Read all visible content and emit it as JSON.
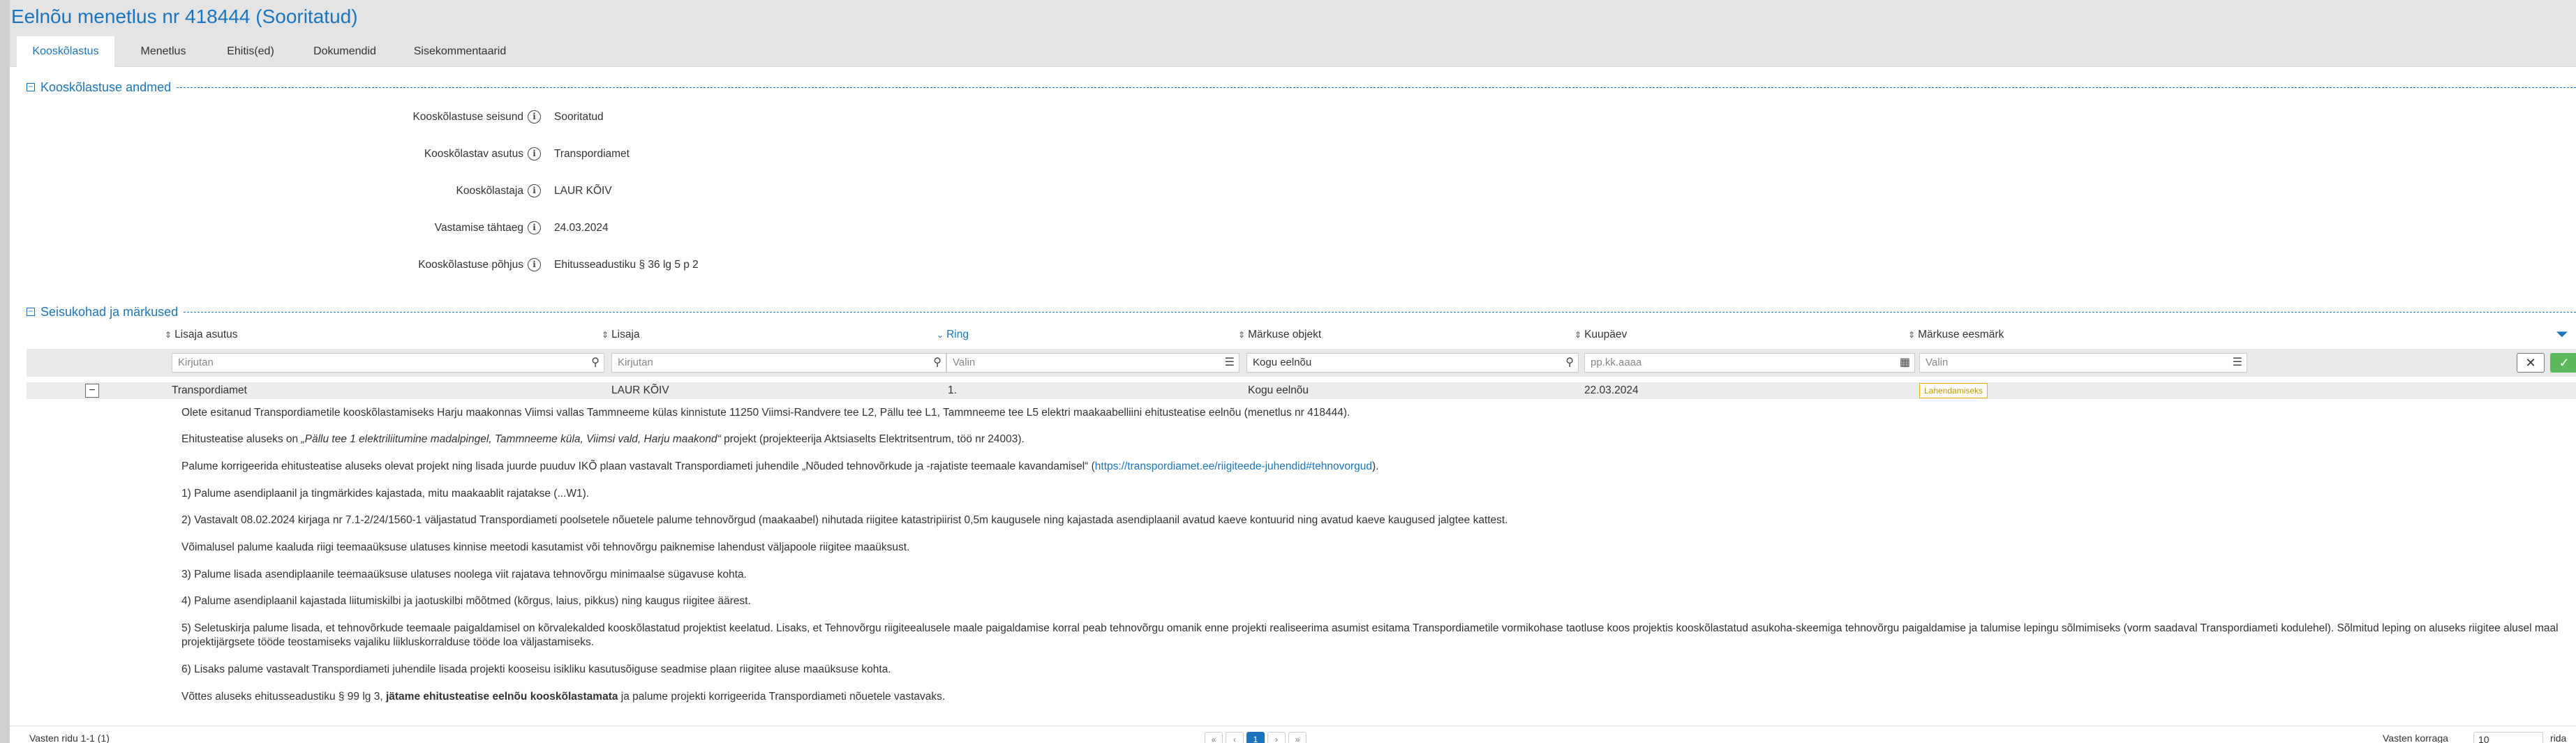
{
  "header": {
    "title": "Eelnõu menetlus nr 418444 (Sooritatud)"
  },
  "tabs": [
    {
      "label": "Kooskõlastus"
    },
    {
      "label": "Menetlus"
    },
    {
      "label": "Ehitis(ed)"
    },
    {
      "label": "Dokumendid"
    },
    {
      "label": "Sisekommentaarid"
    }
  ],
  "section_info": {
    "title": "Kooskõlastuse andmed",
    "fields": [
      {
        "label": "Kooskõlastuse seisund",
        "value": "Sooritatud"
      },
      {
        "label": "Kooskõlastav asutus",
        "value": "Transpordiamet"
      },
      {
        "label": "Kooskõlastaja",
        "value": "LAUR KÕIV"
      },
      {
        "label": "Vastamise tähtaeg",
        "value": "24.03.2024"
      },
      {
        "label": "Kooskõlastuse põhjus",
        "value": "Ehitusseadustiku § 36 lg 5 p 2"
      }
    ]
  },
  "section_remarks": {
    "title": "Seisukohad ja märkused",
    "columns": [
      "Lisaja asutus",
      "Lisaja",
      "Ring",
      "Märkuse objekt",
      "Kuupäev",
      "Märkuse eesmärk"
    ],
    "filters": {
      "lisaja_asutus_placeholder": "Kirjutan",
      "lisaja_placeholder": "Kirjutan",
      "ring_placeholder": "Valin",
      "objekt_value": "Kogu eelnõu",
      "kuupaev_placeholder": "pp.kk.aaaa",
      "eesmark_placeholder": "Valin",
      "clear_glyph": "✕",
      "apply_glyph": "✓"
    },
    "row": {
      "toggle": "−",
      "asutus": "Transpordiamet",
      "lisaja": "LAUR KÕIV",
      "ring": "1.",
      "objekt": "Kogu eelnõu",
      "kuupaev": "22.03.2024",
      "eesmark": "Lahendamiseks"
    },
    "body": {
      "p1": "Olete esitanud Transpordiametile kooskõlastamiseks Harju maakonnas Viimsi vallas Tammneeme külas kinnistute 11250 Viimsi-Randvere tee L2, Pällu tee L1, Tammneeme tee L5 elektri maakaabelliini ehitusteatise eelnõu (menetlus nr 418444).",
      "p2_a": "Ehitusteatise aluseks on ",
      "p2_b": "„Pällu tee 1 elektriliitumine madalpingel, Tammneeme küla, Viimsi vald, Harju maakond“",
      "p2_c": " projekt (projekteerija Aktsiaselts Elektritsentrum, töö nr 24003).",
      "p3_a": "Palume korrigeerida ehitusteatise aluseks olevat projekt ning lisada juurde puuduv IKÕ plaan vastavalt Transpordiameti juhendile „Nõuded tehnovõrkude ja -rajatiste teemaale kavandamisel“ (",
      "p3_link": "https://transpordiamet.ee/riigiteede-juhendid#tehnovorgud",
      "p3_c": ").",
      "p4": "1) Palume asendiplaanil ja tingmärkides kajastada, mitu maakaablit rajatakse (...W1).",
      "p5": "2) Vastavalt 08.02.2024 kirjaga nr 7.1-2/24/1560-1 väljastatud Transpordiameti poolsetele nõuetele palume tehnovõrgud (maakaabel) nihutada riigitee katastripiirist 0,5m kaugusele ning kajastada asendiplaanil avatud kaeve kontuurid ning avatud kaeve kaugused jalgtee kattest.",
      "p6": "Võimalusel palume kaaluda riigi teemaaüksuse ulatuses kinnise meetodi kasutamist või tehnovõrgu paiknemise lahendust väljapoole riigitee maaüksust.",
      "p7": "3) Palume lisada asendiplaanile teemaaüksuse ulatuses noolega viit rajatava tehnovõrgu minimaalse sügavuse kohta.",
      "p8": "4) Palume asendiplaanil kajastada liitumiskilbi ja jaotuskilbi mõõtmed (kõrgus, laius, pikkus) ning kaugus riigitee äärest.",
      "p9": "5) Seletuskirja palume lisada, et tehnovõrkude teemaale paigaldamisel on kõrvalekalded kooskõlastatud projektist keelatud. Lisaks, et Tehnovõrgu riigiteealusele maale paigaldamise korral peab tehnovõrgu omanik enne projekti realiseerima asumist esitama Transpordiametile vormikohase taotluse koos projektis kooskõlastatud asukoha-skeemiga tehnovõrgu paigaldamise ja talumise lepingu sõlmimiseks (vorm saadaval Transpordiameti kodulehel). Sõlmitud leping on aluseks riigitee alusel maal projektijärgsete tööde teostamiseks vajaliku liikluskorralduse tööde loa väljastamiseks.",
      "p10": "6) Lisaks palume vastavalt Transpordiameti juhendile lisada projekti kooseisu isikliku kasutusõiguse seadmise plaan riigitee aluse maaüksuse kohta.",
      "p11_a": "Võttes aluseks ehitusseadustiku § 99 lg 3, ",
      "p11_b": "jätame ehitusteatise eelnõu kooskõlastamata",
      "p11_c": " ja palume projekti korrigeerida Transpordiameti nõuetele vastavaks."
    }
  },
  "pager": {
    "rows_text": "Vasten ridu 1-1 (1)",
    "first": "«",
    "prev": "‹",
    "page": "1",
    "next": "›",
    "last": "»",
    "per_page_label": "Vasten korraga",
    "per_page_value": "10",
    "per_page_suffix": "rida"
  },
  "icons": {
    "info": "info-icon",
    "search": "search-icon",
    "list": "list-icon",
    "calendar": "calendar-icon",
    "funnel": "filter-icon"
  },
  "colors": {
    "accent": "#1c75bc",
    "badge": "#f0b400",
    "apply": "#5cb85c"
  }
}
